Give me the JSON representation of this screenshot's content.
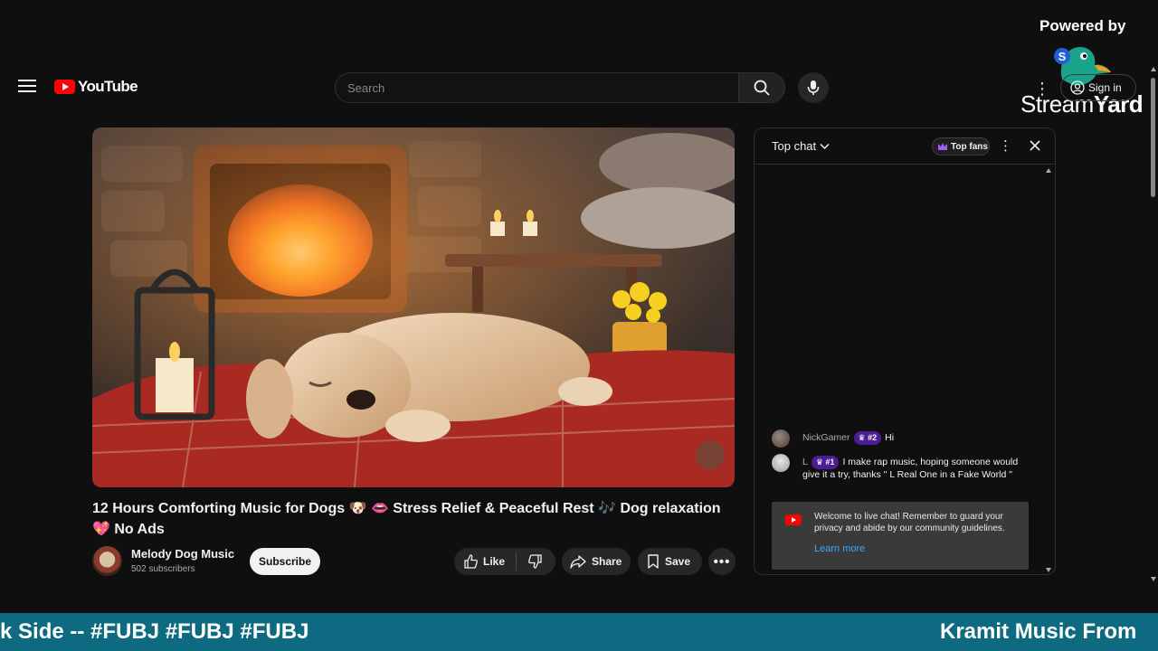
{
  "header": {
    "logo_text": "YouTube",
    "search_placeholder": "Search",
    "signin_label": "Sign in"
  },
  "overlay": {
    "powered_by": "Powered by",
    "brand_stream": "Stream",
    "brand_yard": "Yard",
    "logo_letter": "S"
  },
  "video": {
    "title": "12 Hours Comforting Music for Dogs 🐶 👄 Stress Relief & Peaceful Rest 🎶 Dog relaxation 💖 No Ads",
    "channel_name": "Melody Dog Music",
    "subscribers": "502 subscribers",
    "subscribe_label": "Subscribe",
    "like_label": "Like",
    "share_label": "Share",
    "save_label": "Save"
  },
  "chat": {
    "mode_label": "Top chat",
    "top_fans_label": "Top fans",
    "messages": [
      {
        "author": "NickGamer",
        "badge": "#2",
        "text": "Hi"
      },
      {
        "author": "L",
        "badge": "#1",
        "text": "I make rap music, hoping someone would give it a try, thanks \" L Real One in a Fake World \""
      }
    ],
    "welcome_text": "Welcome to live chat! Remember to guard your privacy and abide by our community guidelines.",
    "learn_more": "Learn more"
  },
  "ticker": {
    "left_text": "k Side -- #FUBJ #FUBJ #FUBJ",
    "right_text": "Kramit Music From"
  },
  "colors": {
    "background": "#0f0f0f",
    "youtube_red": "#ff0000",
    "ticker_bg": "#0e6a80",
    "badge_purple": "#4c1d95",
    "link_blue": "#3ea6ff"
  }
}
